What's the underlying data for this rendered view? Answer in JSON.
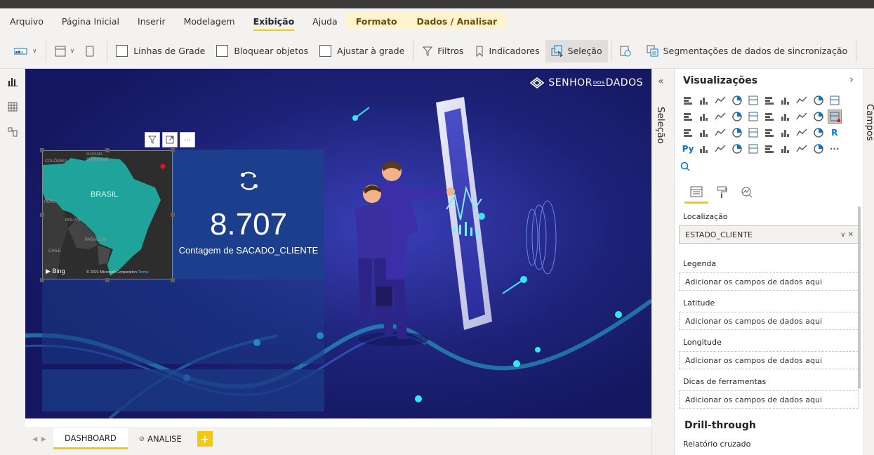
{
  "menu": {
    "items": [
      "Arquivo",
      "Página Inicial",
      "Inserir",
      "Modelagem",
      "Exibição",
      "Ajuda"
    ],
    "active_index": 4,
    "contextual": [
      "Formato",
      "Dados / Analisar"
    ]
  },
  "toolbar": {
    "gridlines": "Linhas de Grade",
    "lock": "Bloquear objetos",
    "snap": "Ajustar à grade",
    "filters": "Filtros",
    "bookmarks": "Indicadores",
    "selection": "Seleção",
    "sync": "Segmentações de dados de sincronização"
  },
  "canvas": {
    "logo_a": "SENHOR",
    "logo_b": "DOS",
    "logo_c": "DADOS",
    "kpi": {
      "value": "8.707",
      "label": "Contagem de SACADO_CLIENTE"
    },
    "map": {
      "labels": [
        "COLÔMBIA",
        "GUIANA",
        "SURINAME",
        "BRASIL",
        "PERU",
        "BOLÍVIA",
        "PARAGUAI",
        "CHILE"
      ],
      "bing": "Bing",
      "copyright": "© 2021 Microsoft Corporation",
      "terms": "Terms"
    }
  },
  "tabs": {
    "items": [
      {
        "label": "DASHBOARD",
        "active": true,
        "hidden": false
      },
      {
        "label": "ANALISE",
        "active": false,
        "hidden": true
      }
    ],
    "add": "+"
  },
  "selection_pane": {
    "label": "Seleção",
    "collapse_icon": "«"
  },
  "visualizations": {
    "title": "Visualizações",
    "chevron": "›",
    "more": "···",
    "wells": [
      {
        "label": "Localização",
        "value": "ESTADO_CLIENTE",
        "filled": true
      },
      {
        "label": "Legenda",
        "value": "Adicionar os campos de dados aqui",
        "filled": false
      },
      {
        "label": "Latitude",
        "value": "Adicionar os campos de dados aqui",
        "filled": false
      },
      {
        "label": "Longitude",
        "value": "Adicionar os campos de dados aqui",
        "filled": false
      },
      {
        "label": "Dicas de ferramentas",
        "value": "Adicionar os campos de dados aqui",
        "filled": false
      }
    ],
    "drill_title": "Drill-through",
    "drill_sub": "Relatório cruzado"
  },
  "fields_pane": {
    "label": "Campos"
  },
  "colors": {
    "accent": "#f2c811",
    "canvas": "#1a1e70",
    "card": "#1b3f8c",
    "map_land": "#1fa39a"
  }
}
